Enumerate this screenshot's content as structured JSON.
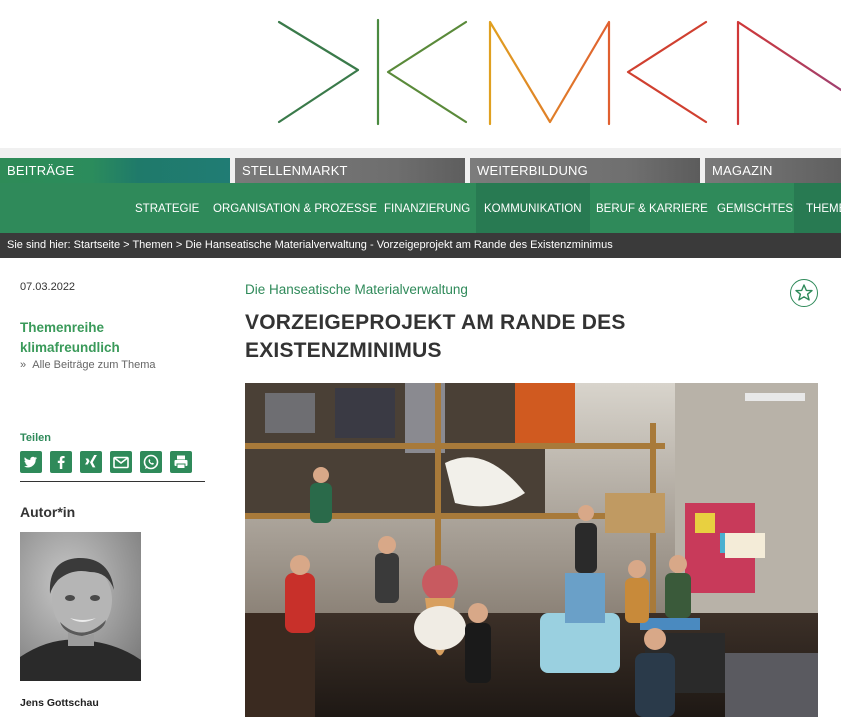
{
  "logo": {
    "icon": "dkmcn-logo"
  },
  "top_nav": {
    "tabs": [
      "BEITRÄGE",
      "STELLENMARKT",
      "WEITERBILDUNG",
      "MAGAZIN"
    ],
    "active": "BEITRÄGE"
  },
  "sub_nav": {
    "items": [
      "STRATEGIE",
      "ORGANISATION & PROZESSE",
      "FINANZIERUNG",
      "KOMMUNIKATION",
      "BERUF & KARRIERE",
      "GEMISCHTES",
      "THEMEN"
    ],
    "active": "KOMMUNIKATION"
  },
  "breadcrumb": "Sie sind hier: Startseite > Themen > Die Hanseatische Materialverwaltung - Vorzeigeprojekt am Rande des Existenzminimus",
  "sidebar": {
    "date": "07.03.2022",
    "series_title": "Themenreihe klimafreundlich",
    "series_link": "Alle Beiträge zum Thema",
    "share_label": "Teilen",
    "share_icons": [
      "twitter-icon",
      "facebook-icon",
      "xing-icon",
      "email-icon",
      "whatsapp-icon",
      "print-icon"
    ],
    "author_heading": "Autor*in",
    "author_name": "Jens Gottschau"
  },
  "article": {
    "kicker": "Die Hanseatische Materialverwaltung",
    "headline": "VORZEIGEPROJEKT AM RANDE DES EXISTENZMINIMUS"
  },
  "colors": {
    "brand_green": "#2f8a5a",
    "accent_green": "#3a9a5a",
    "nav_gray": "#707070",
    "breadcrumb_bg": "#3a3a3a"
  }
}
